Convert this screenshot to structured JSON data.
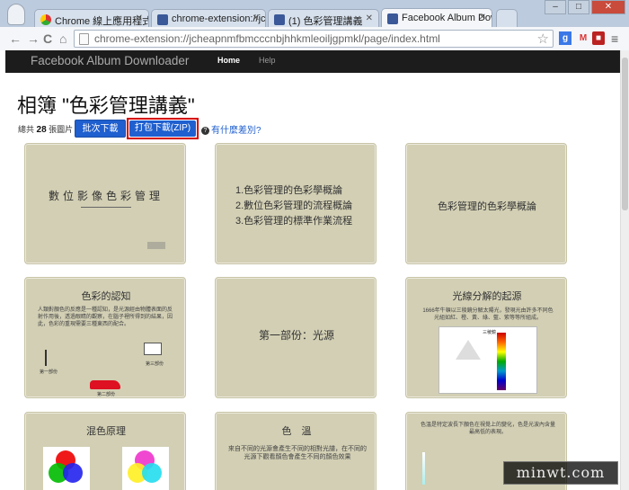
{
  "tabs": [
    {
      "label": "Chrome 線上應用程式商店",
      "active": false
    },
    {
      "label": "chrome-extension://jcheap",
      "active": false
    },
    {
      "label": "(1) 色彩管理講義",
      "active": false
    },
    {
      "label": "Facebook Album Downl",
      "active": true
    }
  ],
  "toolbar": {
    "url": "chrome-extension://jcheapnmfbmcccnbjhhkmleoiljgpmkl/page/index.html",
    "back": "←",
    "forward": "→",
    "reload": "C",
    "home": "⌂",
    "star": "☆",
    "menu": "≡"
  },
  "navbar": {
    "brand": "Facebook Album Downloader",
    "links": [
      {
        "label": "Home",
        "active": true
      },
      {
        "label": "Help",
        "active": false
      }
    ]
  },
  "album": {
    "title": "相簿 \"色彩管理講義\"",
    "count_prefix": "總共",
    "count": "28",
    "count_suffix": "張圖片",
    "batch_button": "批次下載",
    "zip_button": "打包下載(ZIP)",
    "help_link": "有什麼差別?"
  },
  "slides": {
    "s1": {
      "title": "數位影像色彩管理"
    },
    "s2": {
      "items": [
        "1.色彩管理的色彩學概論",
        "2.數位色彩管理的流程概論",
        "3.色彩管理的標準作業流程"
      ]
    },
    "s3": {
      "title": "色彩管理的色彩學概論"
    },
    "s4": {
      "title": "色彩的認知",
      "body": "人類對顏色的反應是一種認知，是光源經由物體表面的反射作用後，透過眼睛的觀察，在腦子裡所得到的結果，因此，色彩的重現需要三種東西的配合。",
      "labels": [
        "第一部份",
        "第二部份",
        "第三部份"
      ]
    },
    "s5": {
      "title": "第一部份：光源"
    },
    "s6": {
      "title": "光線分解的起源",
      "body": "1666年牛頓以三稜鏡分解太陽光，發現光由許多不同色光組如紅、橙、黃、綠、藍、紫等等所組成。",
      "label": "三稜鏡"
    },
    "s7": {
      "title": "混色原理"
    },
    "s8": {
      "title": "色　溫",
      "body": "來自不同的光源會產生不同的相對光譜，在不同的光源下觀看顏色會產生不同的顏色效果"
    },
    "s9": {
      "body": "色溫是特定波長下顏色在視覺上的變化，色是光波內含量最高低的表現。"
    }
  },
  "watermark": "minwt.com",
  "colors": {
    "navbar": "#1c1c1c",
    "button": "#1f5fcf",
    "highlight": "#d40000",
    "slide": "#d2cfb4"
  }
}
